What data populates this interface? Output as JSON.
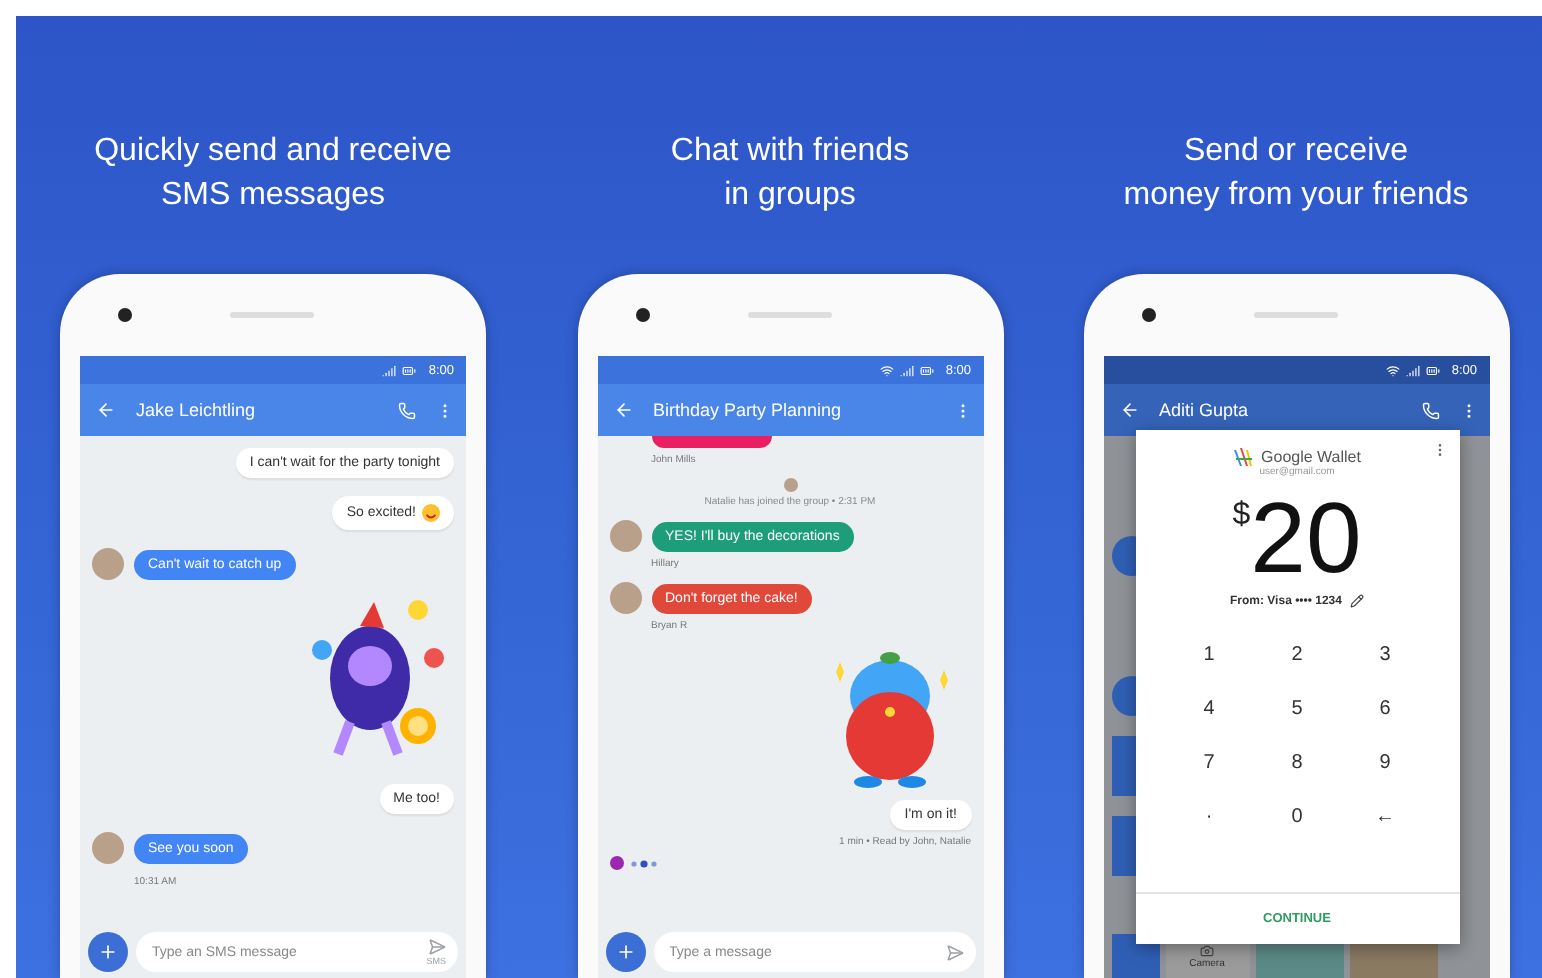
{
  "panels": [
    {
      "caption": [
        "Quickly send and receive",
        "SMS messages"
      ],
      "status": {
        "time": "8:00",
        "wifi": false
      },
      "appbar": {
        "title": "Jake Leichtling",
        "call": true
      },
      "messages": [
        {
          "kind": "out",
          "text": "I can't wait for the party tonight",
          "emoji": false
        },
        {
          "kind": "out",
          "text": "So excited!",
          "emoji": true
        },
        {
          "kind": "in",
          "text": "Can't wait to catch up",
          "color": "#4285f4"
        },
        {
          "kind": "monster-sticker"
        },
        {
          "kind": "out",
          "text": "Me too!",
          "emoji": false
        },
        {
          "kind": "in",
          "text": "See you soon",
          "color": "#4285f4"
        },
        {
          "kind": "caption",
          "text": "10:31 AM"
        }
      ],
      "compose": {
        "placeholder": "Type an SMS message",
        "send_label": "SMS"
      }
    },
    {
      "caption": [
        "Chat with friends",
        "in groups"
      ],
      "status": {
        "time": "8:00",
        "wifi": true
      },
      "appbar": {
        "title": "Birthday Party Planning",
        "call": false
      },
      "messages": [
        {
          "kind": "cut-off",
          "color": "#e91e63"
        },
        {
          "kind": "caption",
          "text": "John Mills"
        },
        {
          "kind": "system",
          "text": "Natalie has joined the group • 2:31 PM"
        },
        {
          "kind": "in",
          "text": "YES! I'll buy the decorations",
          "color": "#1e9e78"
        },
        {
          "kind": "caption",
          "text": "Hillary"
        },
        {
          "kind": "in",
          "text": "Don't forget the cake!",
          "color": "#e0483a"
        },
        {
          "kind": "caption",
          "text": "Bryan R"
        },
        {
          "kind": "bird-sticker"
        },
        {
          "kind": "out",
          "text": "I'm on it!",
          "emoji": false
        },
        {
          "kind": "receipt",
          "text": "1 min • Read by John, Natalie"
        },
        {
          "kind": "typing",
          "color": "#9c27b0"
        }
      ],
      "compose": {
        "placeholder": "Type a message"
      }
    },
    {
      "caption": [
        "Send or receive",
        "money from your friends"
      ],
      "status": {
        "time": "8:00",
        "wifi": true
      },
      "appbar": {
        "title": "Aditi Gupta",
        "call": true
      },
      "background_label": "Camera",
      "wallet": {
        "brand": "Google Wallet",
        "account": "user@gmail.com",
        "currency": "$",
        "amount": "20",
        "source": "From: Visa •••• 1234",
        "keys": [
          "1",
          "2",
          "3",
          "4",
          "5",
          "6",
          "7",
          "8",
          "9",
          "·",
          "0",
          "←"
        ],
        "action": "CONTINUE"
      }
    }
  ]
}
